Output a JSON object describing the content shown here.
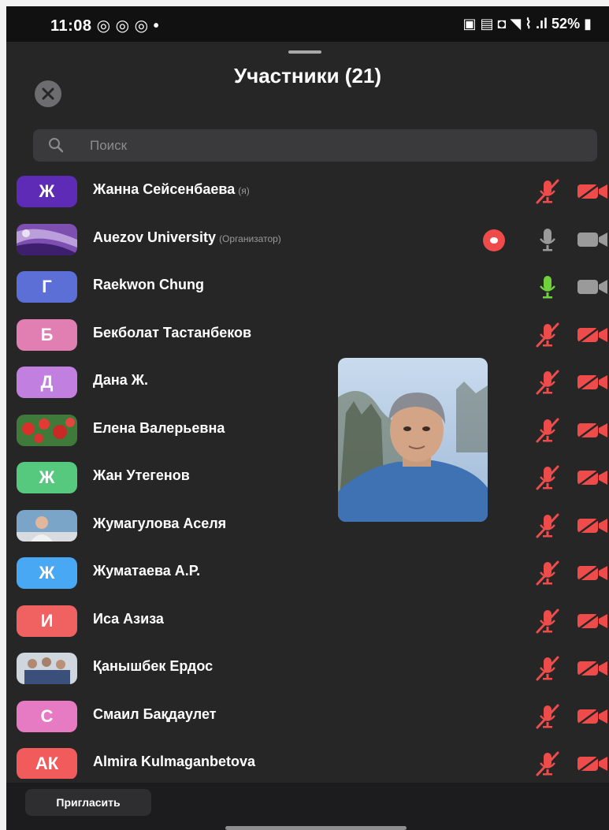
{
  "status_bar": {
    "time": "11:08",
    "icons_left": "◎ ◎ ◎ •",
    "icons_right": "▣ ▤ ◘ ◥ ⌇ .ıl",
    "battery": "52%"
  },
  "header": {
    "title": "Участники (21)",
    "close_icon": "close-icon"
  },
  "search": {
    "placeholder": "Поиск"
  },
  "colors": {
    "mic_muted": "#ee4b4b",
    "mic_on": "#6fd13c",
    "cam_off": "#ee4b4b",
    "cam_on": "#9a9a9a",
    "background": "#262627"
  },
  "participants": [
    {
      "initial": "Ж",
      "name": "Жанна Сейсенбаева",
      "role": "(я)",
      "avatar_color": "#5e2bb7",
      "mic": "muted",
      "cam": "off"
    },
    {
      "initial": "",
      "name": "Auezov University",
      "role": "(Организатор)",
      "avatar_image": "purple-fabric-photo",
      "recording": true,
      "mic": "gray",
      "cam": "on"
    },
    {
      "initial": "Г",
      "name": "Raekwon Chung",
      "role": "",
      "avatar_color": "#5c6fd6",
      "mic": "on",
      "cam": "on"
    },
    {
      "initial": "Б",
      "name": "Бекболат Тастанбеков",
      "role": "",
      "avatar_color": "#e27fb2",
      "mic": "muted",
      "cam": "off"
    },
    {
      "initial": "Д",
      "name": "Дана Ж.",
      "role": "",
      "avatar_color": "#c180e0",
      "mic": "muted",
      "cam": "off"
    },
    {
      "initial": "",
      "name": "Елена Валерьевна",
      "role": "",
      "avatar_image": "red-flowers-photo",
      "mic": "muted",
      "cam": "off"
    },
    {
      "initial": "Ж",
      "name": "Жан Утегенов",
      "role": "",
      "avatar_color": "#56c97f",
      "mic": "muted",
      "cam": "off"
    },
    {
      "initial": "",
      "name": "Жумагулова Аселя",
      "role": "",
      "avatar_image": "person-photo",
      "mic": "muted",
      "cam": "off"
    },
    {
      "initial": "Ж",
      "name": "Жуматаева А.Р.",
      "role": "",
      "avatar_color": "#48a8f4",
      "mic": "muted",
      "cam": "off"
    },
    {
      "initial": "И",
      "name": "Иса Азиза",
      "role": "",
      "avatar_color": "#f06161",
      "mic": "muted",
      "cam": "off"
    },
    {
      "initial": "",
      "name": "Қанышбек Ердос",
      "role": "",
      "avatar_image": "group-photo",
      "mic": "muted",
      "cam": "off"
    },
    {
      "initial": "С",
      "name": "Смаил Бақдаулет",
      "role": "",
      "avatar_color": "#e67bc4",
      "mic": "muted",
      "cam": "off"
    },
    {
      "initial": "АК",
      "name": "Almira Kulmaganbetova",
      "role": "",
      "avatar_color": "#f15b5b",
      "mic": "muted",
      "cam": "off"
    }
  ],
  "footer": {
    "invite_label": "Пригласить"
  }
}
